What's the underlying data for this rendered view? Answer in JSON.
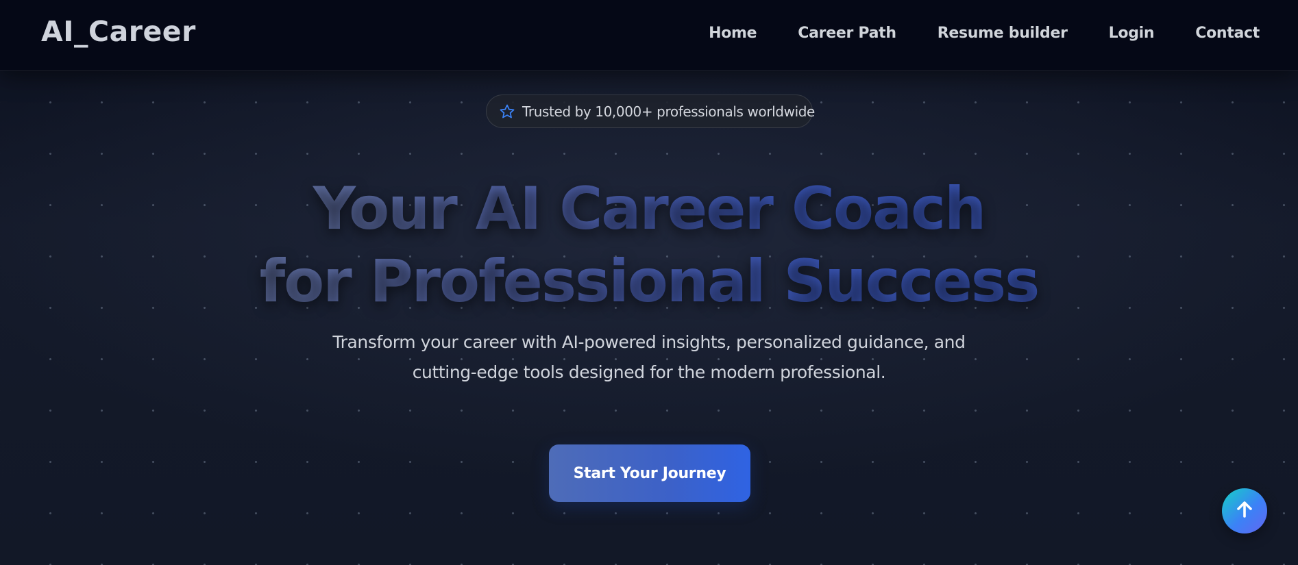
{
  "header": {
    "logo": "AI_Career",
    "nav": [
      "Home",
      "Career Path",
      "Resume builder",
      "Login",
      "Contact"
    ]
  },
  "hero": {
    "badge": {
      "icon": "star-icon",
      "text": "Trusted by 10,000+ professionals worldwide"
    },
    "title_line1": "Your AI Career Coach",
    "title_line2": "for Professional Success",
    "subtitle": "Transform your career with AI-powered insights, personalized guidance, and cutting-edge tools designed for the modern professional.",
    "cta_label": "Start Your Journey"
  },
  "scroll_top": {
    "icon": "arrow-up-icon"
  },
  "colors": {
    "header_bg": "#050816",
    "page_bg": "#121827",
    "accent": "#3b5fc8",
    "star": "#3b82f6",
    "scroll_gradient_start": "#14d1c6",
    "scroll_gradient_end": "#6366f1"
  }
}
